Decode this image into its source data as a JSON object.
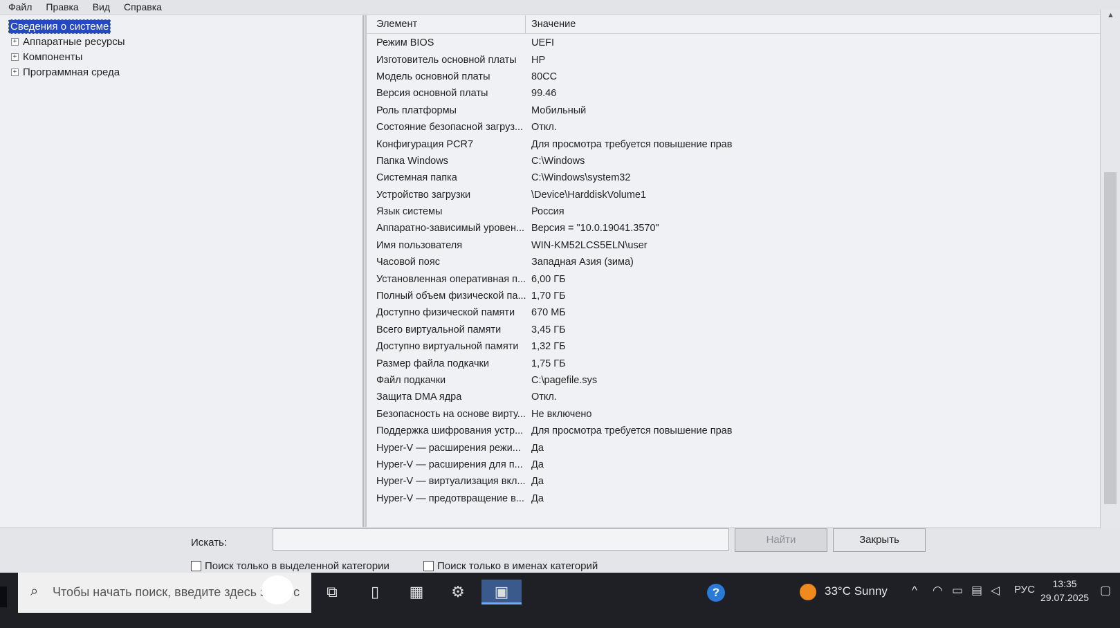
{
  "menu": [
    "Файл",
    "Правка",
    "Вид",
    "Справка"
  ],
  "tree": {
    "root": "Сведения о системе",
    "children": [
      "Аппаратные ресурсы",
      "Компоненты",
      "Программная среда"
    ]
  },
  "table": {
    "headers": [
      "Элемент",
      "Значение"
    ],
    "rows": [
      [
        "Режим BIOS",
        "UEFI"
      ],
      [
        "Изготовитель основной платы",
        "HP"
      ],
      [
        "Модель основной платы",
        "80CC"
      ],
      [
        "Версия основной платы",
        "99.46"
      ],
      [
        "Роль платформы",
        "Мобильный"
      ],
      [
        "Состояние безопасной загруз...",
        "Откл."
      ],
      [
        "Конфигурация PCR7",
        "Для просмотра требуется повышение прав"
      ],
      [
        "Папка Windows",
        "C:\\Windows"
      ],
      [
        "Системная папка",
        "C:\\Windows\\system32"
      ],
      [
        "Устройство загрузки",
        "\\Device\\HarddiskVolume1"
      ],
      [
        "Язык системы",
        "Россия"
      ],
      [
        "Аппаратно-зависимый уровен...",
        "Версия = \"10.0.19041.3570\""
      ],
      [
        "Имя пользователя",
        "WIN-KM52LCS5ELN\\user"
      ],
      [
        "Часовой пояс",
        "Западная Азия (зима)"
      ],
      [
        "Установленная оперативная п...",
        "6,00 ГБ"
      ],
      [
        "Полный объем физической па...",
        "1,70 ГБ"
      ],
      [
        "Доступно физической памяти",
        "670 МБ"
      ],
      [
        "Всего виртуальной памяти",
        "3,45 ГБ"
      ],
      [
        "Доступно виртуальной памяти",
        "1,32 ГБ"
      ],
      [
        "Размер файла подкачки",
        "1,75 ГБ"
      ],
      [
        "Файл подкачки",
        "C:\\pagefile.sys"
      ],
      [
        "Защита DMA ядра",
        "Откл."
      ],
      [
        "Безопасность на основе вирту...",
        "Не включено"
      ],
      [
        "Поддержка шифрования устр...",
        "Для просмотра требуется повышение прав"
      ],
      [
        "Hyper-V — расширения режи...",
        "Да"
      ],
      [
        "Hyper-V — расширения для п...",
        "Да"
      ],
      [
        "Hyper-V — виртуализация вкл...",
        "Да"
      ],
      [
        "Hyper-V — предотвращение в...",
        "Да"
      ]
    ]
  },
  "search": {
    "label": "Искать:",
    "value": "",
    "find_button": "Найти",
    "close_button": "Закрыть",
    "check_selected_category": "Поиск только в выделенной категории",
    "check_category_names": "Поиск только в именах категорий"
  },
  "taskbar": {
    "search_placeholder": "Чтобы начать поиск, введите здесь запрос",
    "weather_temp": "33°C",
    "weather_cond": "Sunny",
    "lang": "РУС",
    "time": "13:35",
    "date": "29.07.2025"
  },
  "icons": {
    "tree_expander": "plus-box",
    "search": "magnifier-icon",
    "task_view": "task-view-icon",
    "file": "file-icon",
    "store": "store-icon",
    "settings": "gear-icon",
    "msinfo": "system-info-icon",
    "help": "help-icon"
  }
}
